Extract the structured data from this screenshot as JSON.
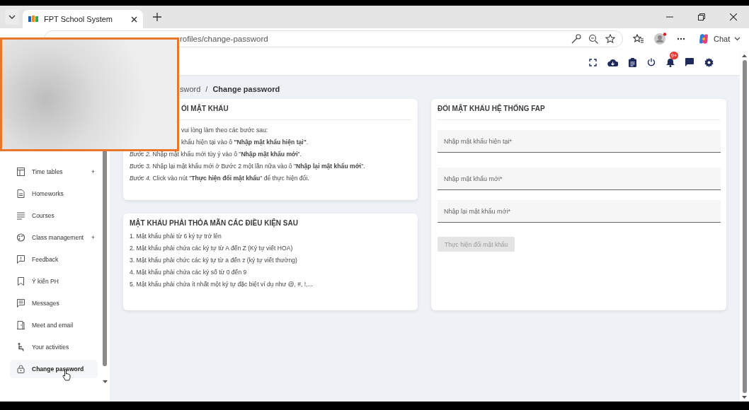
{
  "browser": {
    "tab_title": "FPT School System",
    "url": "rofiles/change-password",
    "chat_label": "Chat"
  },
  "header": {
    "notification_badge": "9+"
  },
  "sidebar": {
    "items": [
      {
        "label": "Time tables",
        "expander": "+",
        "selected": false
      },
      {
        "label": "Homeworks",
        "selected": false
      },
      {
        "label": "Courses",
        "selected": false
      },
      {
        "label": "Class management",
        "expander": "+",
        "selected": false
      },
      {
        "label": "Feedback",
        "selected": false
      },
      {
        "label": "Ý kiến PH",
        "selected": false
      },
      {
        "label": "Messages",
        "selected": false
      },
      {
        "label": "Meet and email",
        "selected": false
      },
      {
        "label": "Your activities",
        "selected": false
      },
      {
        "label": "Change password",
        "selected": true
      }
    ]
  },
  "breadcrumb": {
    "parent": "sword",
    "separator": "/",
    "current": "Change password"
  },
  "instructions_card": {
    "title": "ỔI MẬT KHẨU",
    "lines": [
      "vui lòng làm theo các bước sau:",
      "khẩu hiện tại vào ô **\"Nhập mật khẩu hiện tại\"**.",
      "*Bước 2.* Nhập mật khẩu mới tùy ý vào ô \"**Nhập mật khẩu mới**\".",
      "*Bước 3.* Nhập lại mật khẩu mới ở Bước 2 một lần nữa vào ô \"**Nhập lại mật khẩu mới**\".",
      "*Bước 4.* Click vào nút \"**Thực hiện đổi mật khẩu**\" để thực hiện đổi."
    ]
  },
  "rules_card": {
    "title": "MẬT KHẨU PHẢI THỎA MÃN CÁC ĐIỀU KIỆN SAU",
    "items": [
      "1. Mật khẩu phải từ 6 ký tự trở lên",
      "2. Mật khẩu phải chứa các ký tự từ A đến Z (Ký tự viết HOA)",
      "3. Mật khẩu phải chức các ký tự từ a đến z (ký tự viết thường)",
      "4. Mật khẩu phải chứa các ký số từ 0 đến 9",
      "5. Mật khẩu phải chứa ít nhất một ký tự đặc biệt ví dụ như @, #, !,..."
    ]
  },
  "form_card": {
    "title": "ĐỔI MẬT KHẨU HỆ THỐNG FAP",
    "fields": [
      {
        "placeholder": "Nhập mật khẩu hiện tại*"
      },
      {
        "placeholder": "Nhập mật khẩu mới*"
      },
      {
        "placeholder": "Nhập lại mật khẩu mới*"
      }
    ],
    "submit": {
      "label": "Thực hiện đổi mật khẩu",
      "disabled": true
    }
  }
}
